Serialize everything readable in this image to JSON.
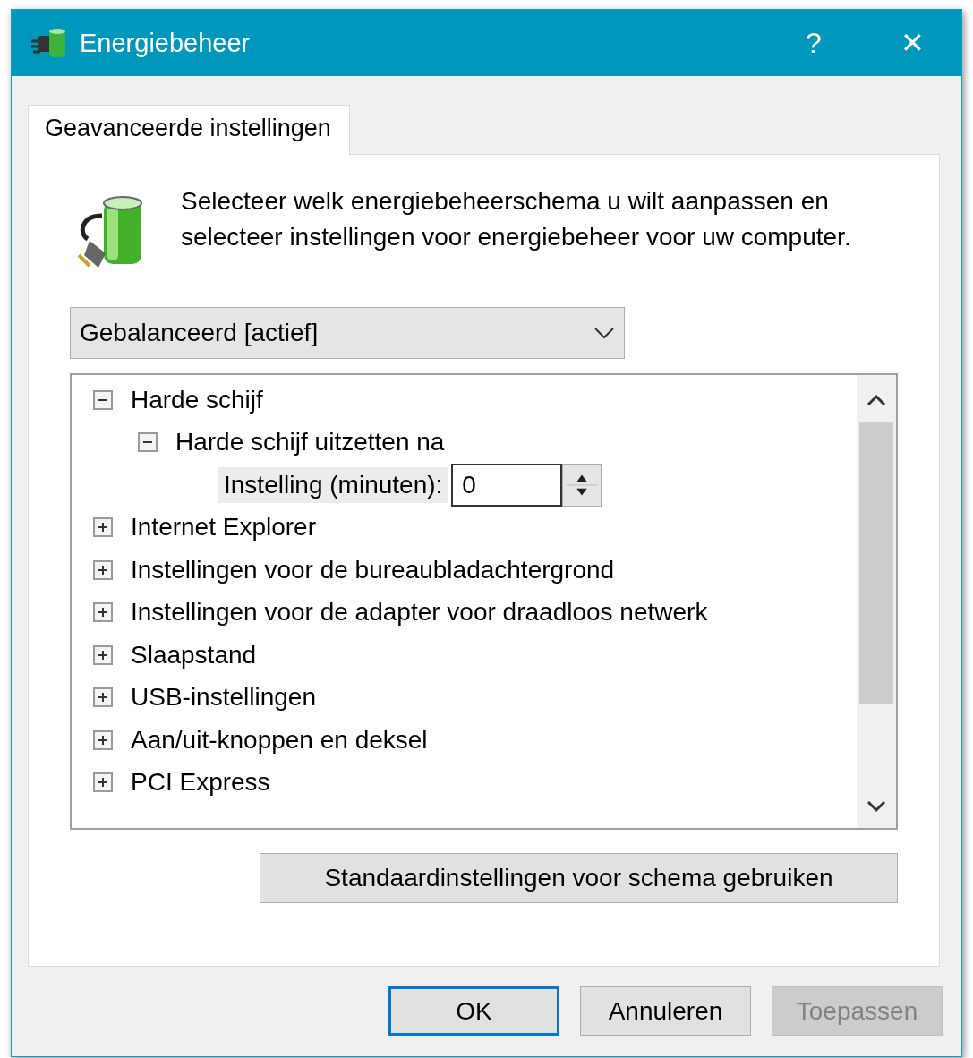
{
  "window": {
    "title": "Energiebeheer",
    "buttons": [
      "?",
      "✕"
    ]
  },
  "tabs": [
    {
      "label": "Geavanceerde instellingen",
      "selected": true
    }
  ],
  "description": "Selecteer welk energiebeheerschema u wilt aanpassen en selecteer instellingen voor energiebeheer voor uw computer.",
  "plan_dropdown": {
    "value": "Gebalanceerd [actief]"
  },
  "tree": [
    {
      "label": "Harde schijf",
      "expanded": true,
      "children": [
        {
          "label": "Harde schijf uitzetten na",
          "expanded": true,
          "children": [
            {
              "kind": "setting",
              "label": "Instelling (minuten):",
              "value": "0"
            }
          ]
        }
      ]
    },
    {
      "label": "Internet Explorer",
      "expanded": false
    },
    {
      "label": "Instellingen voor de bureaubladachtergrond",
      "expanded": false
    },
    {
      "label": "Instellingen voor de adapter voor draadloos netwerk",
      "expanded": false
    },
    {
      "label": "Slaapstand",
      "expanded": false
    },
    {
      "label": "USB-instellingen",
      "expanded": false
    },
    {
      "label": "Aan/uit-knoppen en deksel",
      "expanded": false
    },
    {
      "label": "PCI Express",
      "expanded": false
    }
  ],
  "restore_button": "Standaardinstellingen voor schema gebruiken",
  "buttons": [
    {
      "label": "OK",
      "default": true,
      "disabled": false
    },
    {
      "label": "Annuleren",
      "default": false,
      "disabled": false
    },
    {
      "label": "Toepassen",
      "default": false,
      "disabled": true
    }
  ]
}
